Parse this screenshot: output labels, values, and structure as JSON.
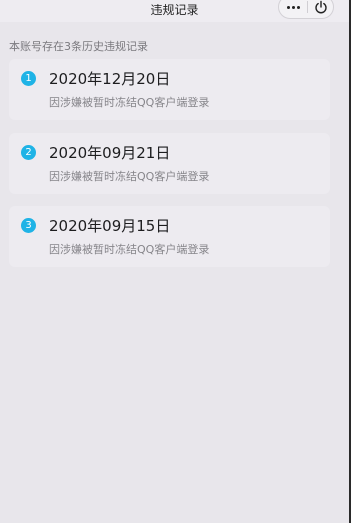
{
  "header": {
    "title": "违规记录"
  },
  "summary": "本账号存在3条历史违规记录",
  "records": [
    {
      "index": "1",
      "date": "2020年12月20日",
      "reason": "因涉嫌被暂时冻结QQ客户端登录"
    },
    {
      "index": "2",
      "date": "2020年09月21日",
      "reason": "因涉嫌被暂时冻结QQ客户端登录"
    },
    {
      "index": "3",
      "date": "2020年09月15日",
      "reason": "因涉嫌被暂时冻结QQ客户端登录"
    }
  ],
  "icons": {
    "more": "more-dots-icon",
    "close": "power-icon"
  },
  "colors": {
    "badge": "#1fb3e6",
    "background": "#e8e6eb",
    "card": "#edebf0"
  }
}
